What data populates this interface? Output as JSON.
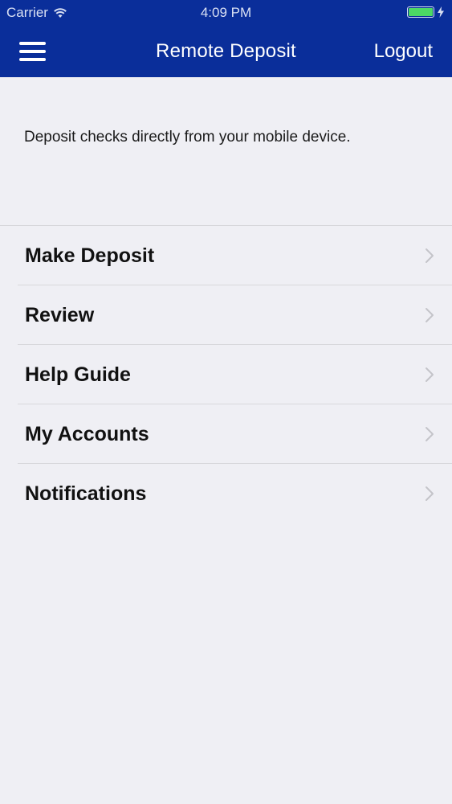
{
  "status_bar": {
    "carrier": "Carrier",
    "time": "4:09 PM",
    "wifi_icon": "wifi-icon",
    "battery_icon": "battery-icon",
    "charging_icon": "bolt-icon"
  },
  "nav": {
    "title": "Remote Deposit",
    "logout_label": "Logout",
    "menu_icon": "hamburger-menu-icon"
  },
  "intro_text": "Deposit checks directly from your mobile device.",
  "menu": {
    "items": [
      {
        "label": "Make Deposit",
        "icon": "chevron-right-icon"
      },
      {
        "label": "Review",
        "icon": "chevron-right-icon"
      },
      {
        "label": "Help Guide",
        "icon": "chevron-right-icon"
      },
      {
        "label": "My Accounts",
        "icon": "chevron-right-icon"
      },
      {
        "label": "Notifications",
        "icon": "chevron-right-icon"
      }
    ]
  },
  "colors": {
    "nav_background": "#0a2e9a",
    "page_background": "#efeff4",
    "battery": "#4cd964"
  }
}
